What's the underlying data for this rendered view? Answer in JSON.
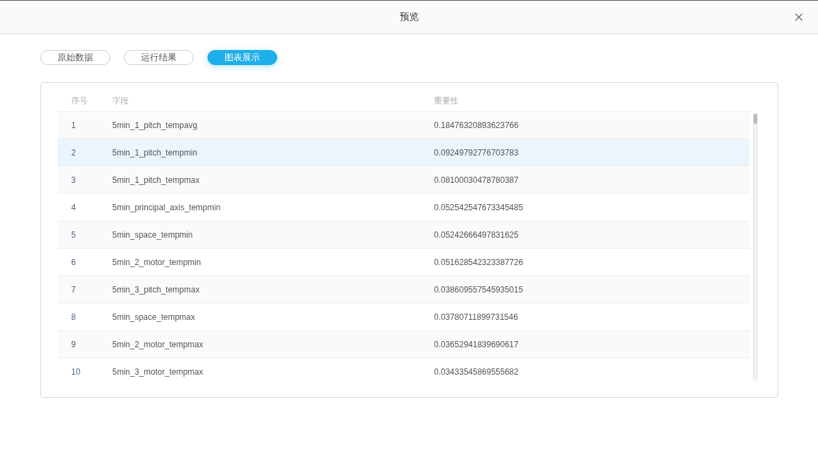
{
  "dialog": {
    "title": "预览"
  },
  "tabs": [
    {
      "label": "原始数据",
      "selected": false
    },
    {
      "label": "运行结果",
      "selected": false
    },
    {
      "label": "图表展示",
      "selected": true
    }
  ],
  "table": {
    "columns": [
      "序号",
      "字段",
      "重要性"
    ],
    "rows": [
      {
        "cells": [
          "1",
          "5min_1_pitch_tempavg",
          "0.18476320893623766"
        ],
        "selected": false
      },
      {
        "cells": [
          "2",
          "5min_1_pitch_tempmin",
          "0.09249792776703783"
        ],
        "selected": true
      },
      {
        "cells": [
          "3",
          "5min_1_pitch_tempmax",
          "0.08100030478780387"
        ],
        "selected": false
      },
      {
        "cells": [
          "4",
          "5min_principal_axis_tempmin",
          "0.052542547673345485"
        ],
        "selected": false
      },
      {
        "cells": [
          "5",
          "5min_space_tempmin",
          "0.05242666497831625"
        ],
        "selected": false
      },
      {
        "cells": [
          "6",
          "5min_2_motor_tempmin",
          "0.051628542323387726"
        ],
        "selected": false
      },
      {
        "cells": [
          "7",
          "5min_3_pitch_tempmax",
          "0.038609557545935015"
        ],
        "selected": false
      },
      {
        "cells": [
          "8",
          "5min_space_tempmax",
          "0.03780711899731546"
        ],
        "selected": false
      },
      {
        "cells": [
          "9",
          "5min_2_motor_tempmax",
          "0.03652941839690617"
        ],
        "selected": false
      },
      {
        "cells": [
          "10",
          "5min_3_motor_tempmax",
          "0.03433545869555682"
        ],
        "selected": false
      }
    ]
  }
}
